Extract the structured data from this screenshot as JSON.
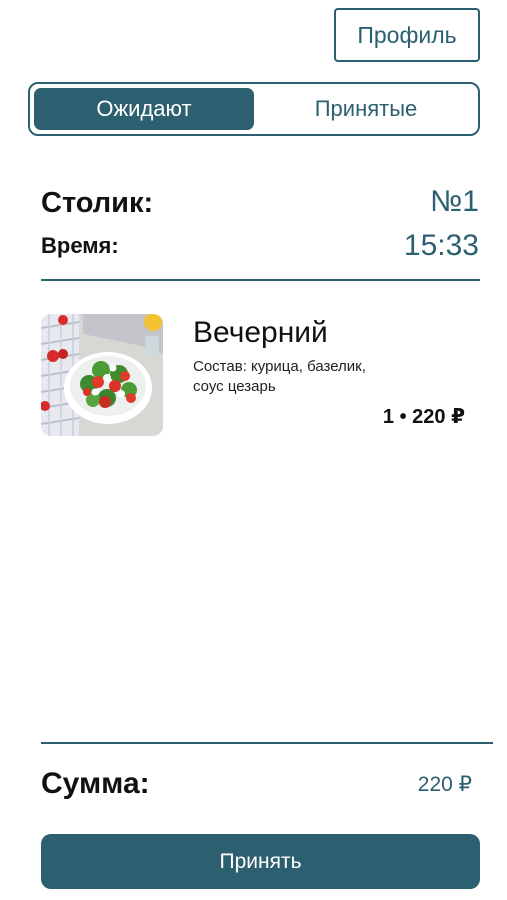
{
  "header": {
    "profile_label": "Профиль"
  },
  "tabs": [
    {
      "label": "Ожидают",
      "active": true
    },
    {
      "label": "Принятые",
      "active": false
    }
  ],
  "order": {
    "table_label": "Столик:",
    "table_value": "№1",
    "time_label": "Время:",
    "time_value": "15:33"
  },
  "items": [
    {
      "name": "Вечерний",
      "description_line1": "Состав: курица, базелик,",
      "description_line2": "соус цезарь",
      "quantity_price": "1 • 220 ₽",
      "image_icon": "salad-photo"
    }
  ],
  "summary": {
    "label": "Сумма:",
    "value": "220 ₽"
  },
  "actions": {
    "accept_label": "Принять"
  },
  "colors": {
    "accent": "#2c5f70",
    "text": "#111111",
    "background": "#ffffff"
  }
}
